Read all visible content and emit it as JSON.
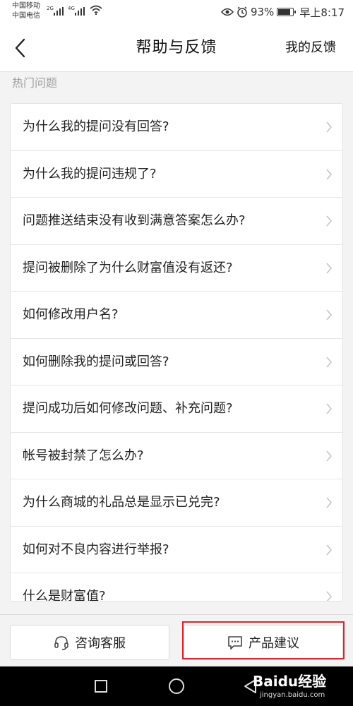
{
  "status_bar": {
    "carrier1": "中国移动",
    "carrier2": "中国电信",
    "network1": "2G",
    "network2": "4G",
    "battery_percent": "93%",
    "battery_level": 0.93,
    "time": "早上8:17",
    "icons": [
      "signal-icon",
      "wifi-icon",
      "eye-icon",
      "alarm-icon",
      "battery-icon"
    ]
  },
  "header": {
    "title": "帮助与反馈",
    "my_feedback": "我的反馈",
    "back_icon": "chevron-left-icon"
  },
  "section_label": "热门问题",
  "questions": [
    "为什么我的提问没有回答?",
    "为什么我的提问违规了?",
    "问题推送结束没有收到满意答案怎么办?",
    "提问被删除了为什么财富值没有返还?",
    "如何修改用户名?",
    "如何删除我的提问或回答?",
    "提问成功后如何修改问题、补充问题?",
    "帐号被封禁了怎么办?",
    "为什么商城的礼品总是显示已兑完?",
    "如何对不良内容进行举报?",
    "什么是财富值?"
  ],
  "bottom": {
    "consult_label": "咨询客服",
    "suggest_label": "产品建议",
    "consult_icon": "headset-icon",
    "suggest_icon": "chat-bubble-icon",
    "highlight_color": "#d9262d"
  },
  "nav": {
    "icons": [
      "square-icon",
      "circle-icon",
      "triangle-back-icon"
    ]
  },
  "watermark": {
    "logo": "Baidu经验",
    "url": "jingyan.baidu.com"
  }
}
